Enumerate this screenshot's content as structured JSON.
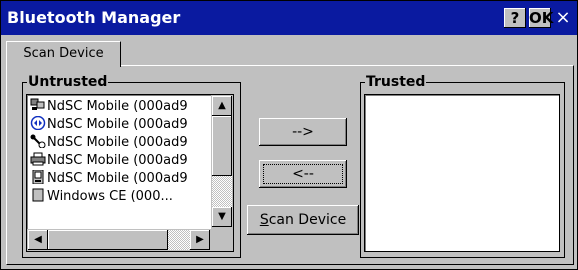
{
  "window": {
    "title": "Bluetooth Manager",
    "help_label": "?",
    "ok_label": "OK",
    "close_label": "×"
  },
  "tab": {
    "label": "Scan Device"
  },
  "untrusted": {
    "label": "Untrusted",
    "items": [
      {
        "text": "NdSC Mobile (000ad9",
        "icon": "network-computer-icon"
      },
      {
        "text": "NdSC Mobile (000ad9",
        "icon": "bluetooth-icon"
      },
      {
        "text": "NdSC Mobile (000ad9",
        "icon": "headset-icon"
      },
      {
        "text": "NdSC Mobile (000ad9",
        "icon": "printer-icon"
      },
      {
        "text": "NdSC Mobile (000ad9",
        "icon": "pda-icon"
      },
      {
        "text": "Windows CE (000...",
        "icon": "device-icon"
      }
    ]
  },
  "buttons": {
    "move_right": "-->",
    "move_left": "<--",
    "scan": "Scan Device",
    "scan_accel": "S",
    "scan_rest": "can Device"
  },
  "trusted": {
    "label": "Trusted",
    "items": []
  }
}
